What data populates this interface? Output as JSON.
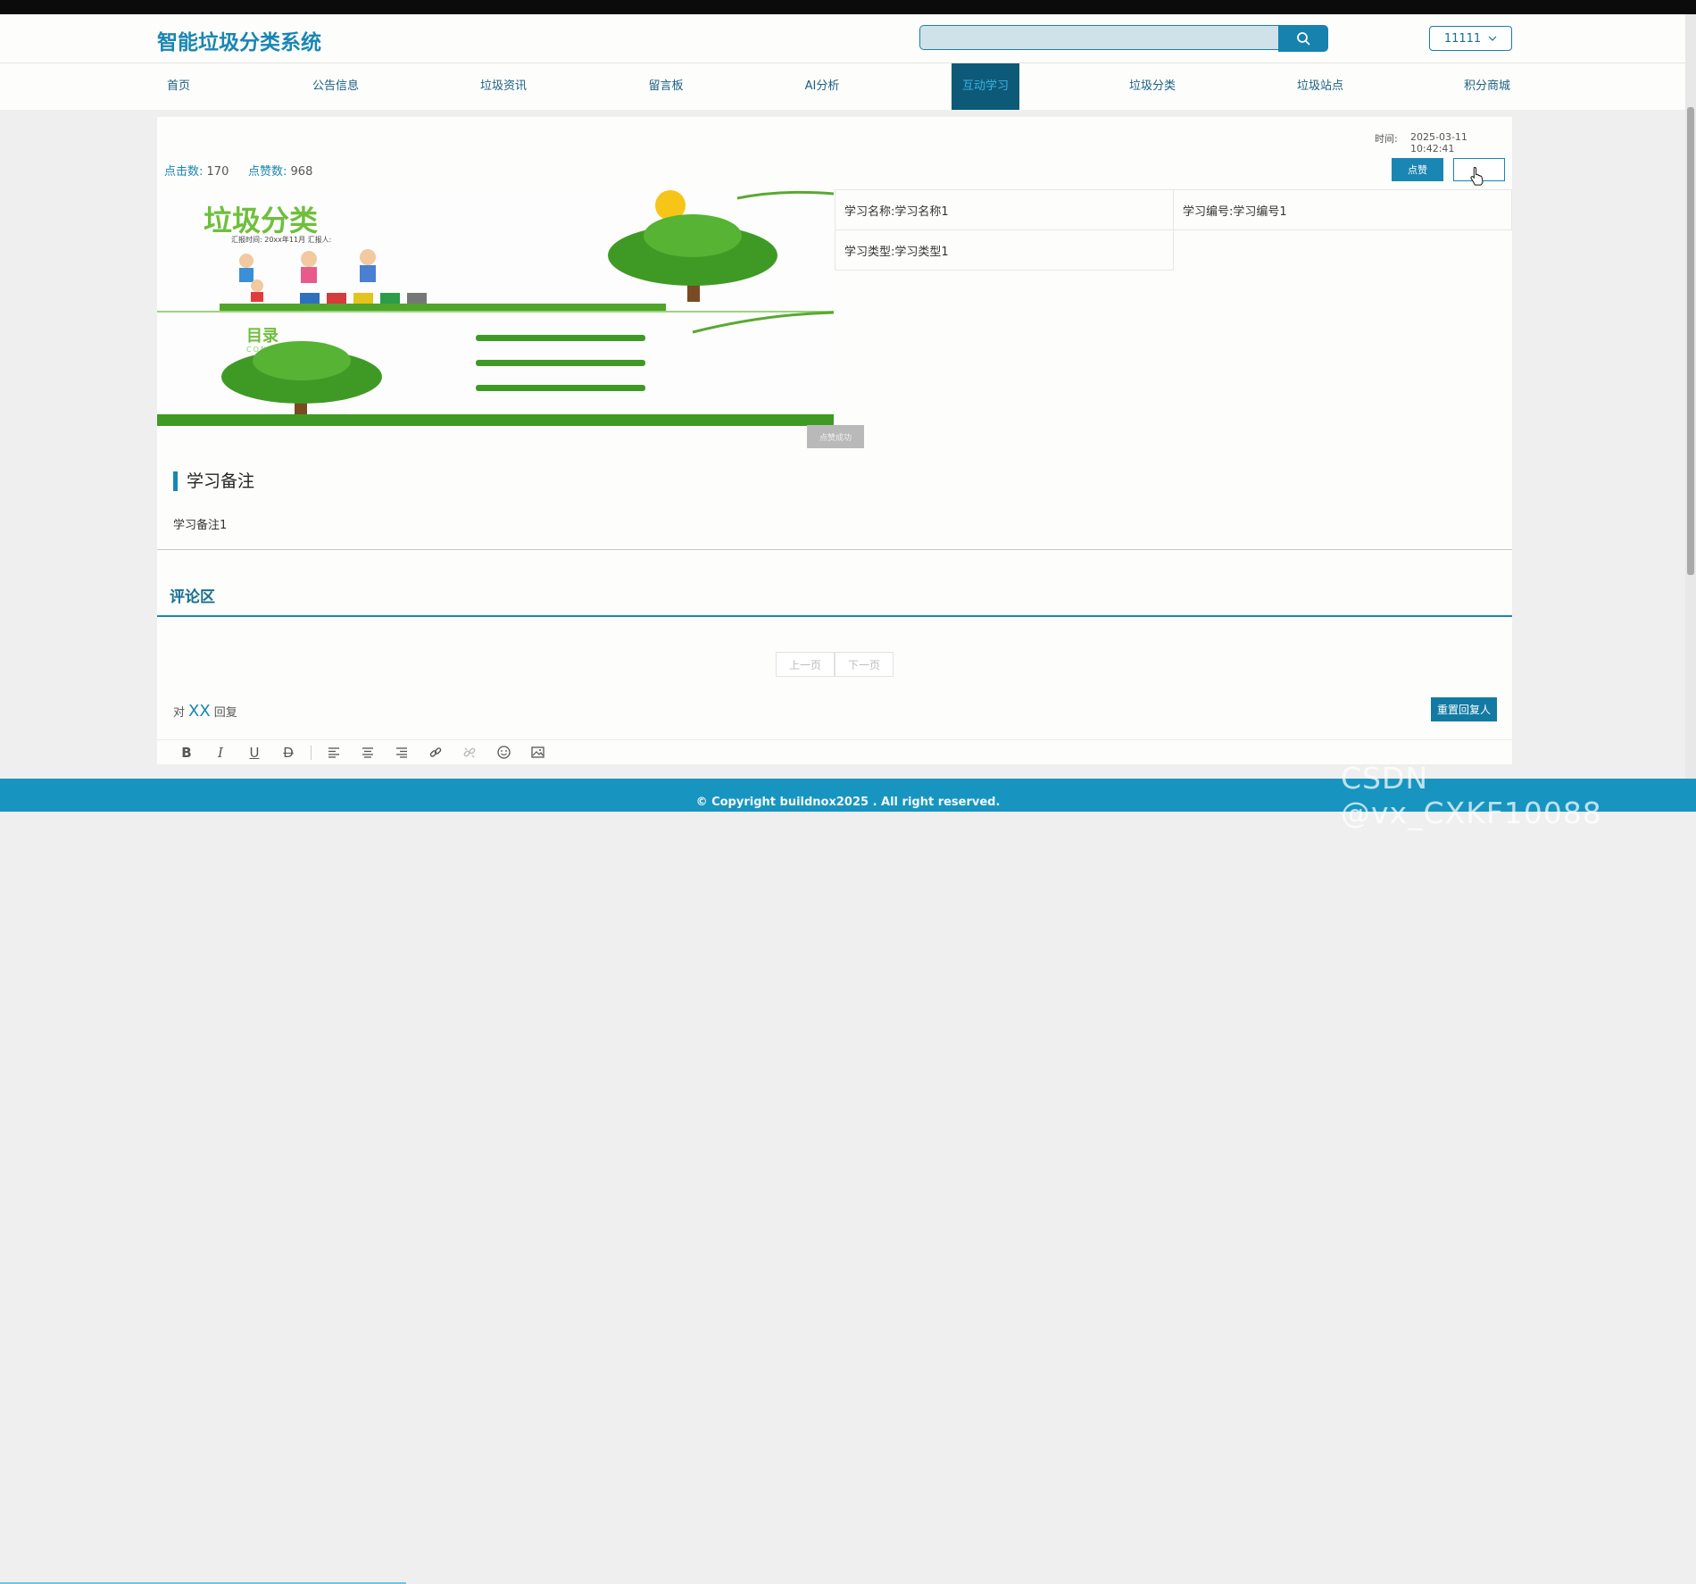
{
  "header": {
    "title": "智能垃圾分类系统",
    "search_placeholder": "",
    "user": "11111"
  },
  "nav": {
    "items": [
      {
        "label": "首页"
      },
      {
        "label": "公告信息"
      },
      {
        "label": "垃圾资讯"
      },
      {
        "label": "留言板"
      },
      {
        "label": "AI分析"
      },
      {
        "label": "互动学习",
        "active": true
      },
      {
        "label": "垃圾分类"
      },
      {
        "label": "垃圾站点"
      },
      {
        "label": "积分商城"
      }
    ]
  },
  "detail": {
    "time_label": "时间:",
    "time_value": "2025-03-11 10:42:41",
    "clicks_label": "点击数:",
    "clicks_value": "170",
    "likes_label": "点赞数:",
    "likes_value": "968",
    "like_button": "点赞",
    "info": {
      "name": "学习名称:学习名称1",
      "code": "学习编号:学习编号1",
      "type": "学习类型:学习类型1"
    },
    "toast": "点赞成功",
    "image_text": {
      "banner_title": "垃圾分类",
      "banner_sub": "汇报时间: 20xx年11月 汇报人:",
      "toc_title": "目录",
      "toc_sub": "CONTANTS"
    },
    "note_title": "学习备注",
    "note_text": "学习备注1"
  },
  "comments": {
    "title": "评论区",
    "prev": "上一页",
    "next": "下一页",
    "reply_prefix": "对",
    "reply_name": "XX",
    "reply_suffix": "回复",
    "reset_button": "重置回复人"
  },
  "editor": {
    "tools": [
      "bold-icon",
      "italic-icon",
      "underline-icon",
      "strikethrough-icon",
      "align-left-icon",
      "align-center-icon",
      "align-right-icon",
      "link-icon",
      "unlink-icon",
      "emoji-icon",
      "image-icon"
    ]
  },
  "footer": {
    "copyright": "© Copyright buildnox2025 . All right reserved."
  },
  "watermark": "CSDN @vx_CXKF10088",
  "colors": {
    "brand": "#1a86b3",
    "nav_active_bg": "#0d5a78",
    "footer": "#1795c0"
  }
}
